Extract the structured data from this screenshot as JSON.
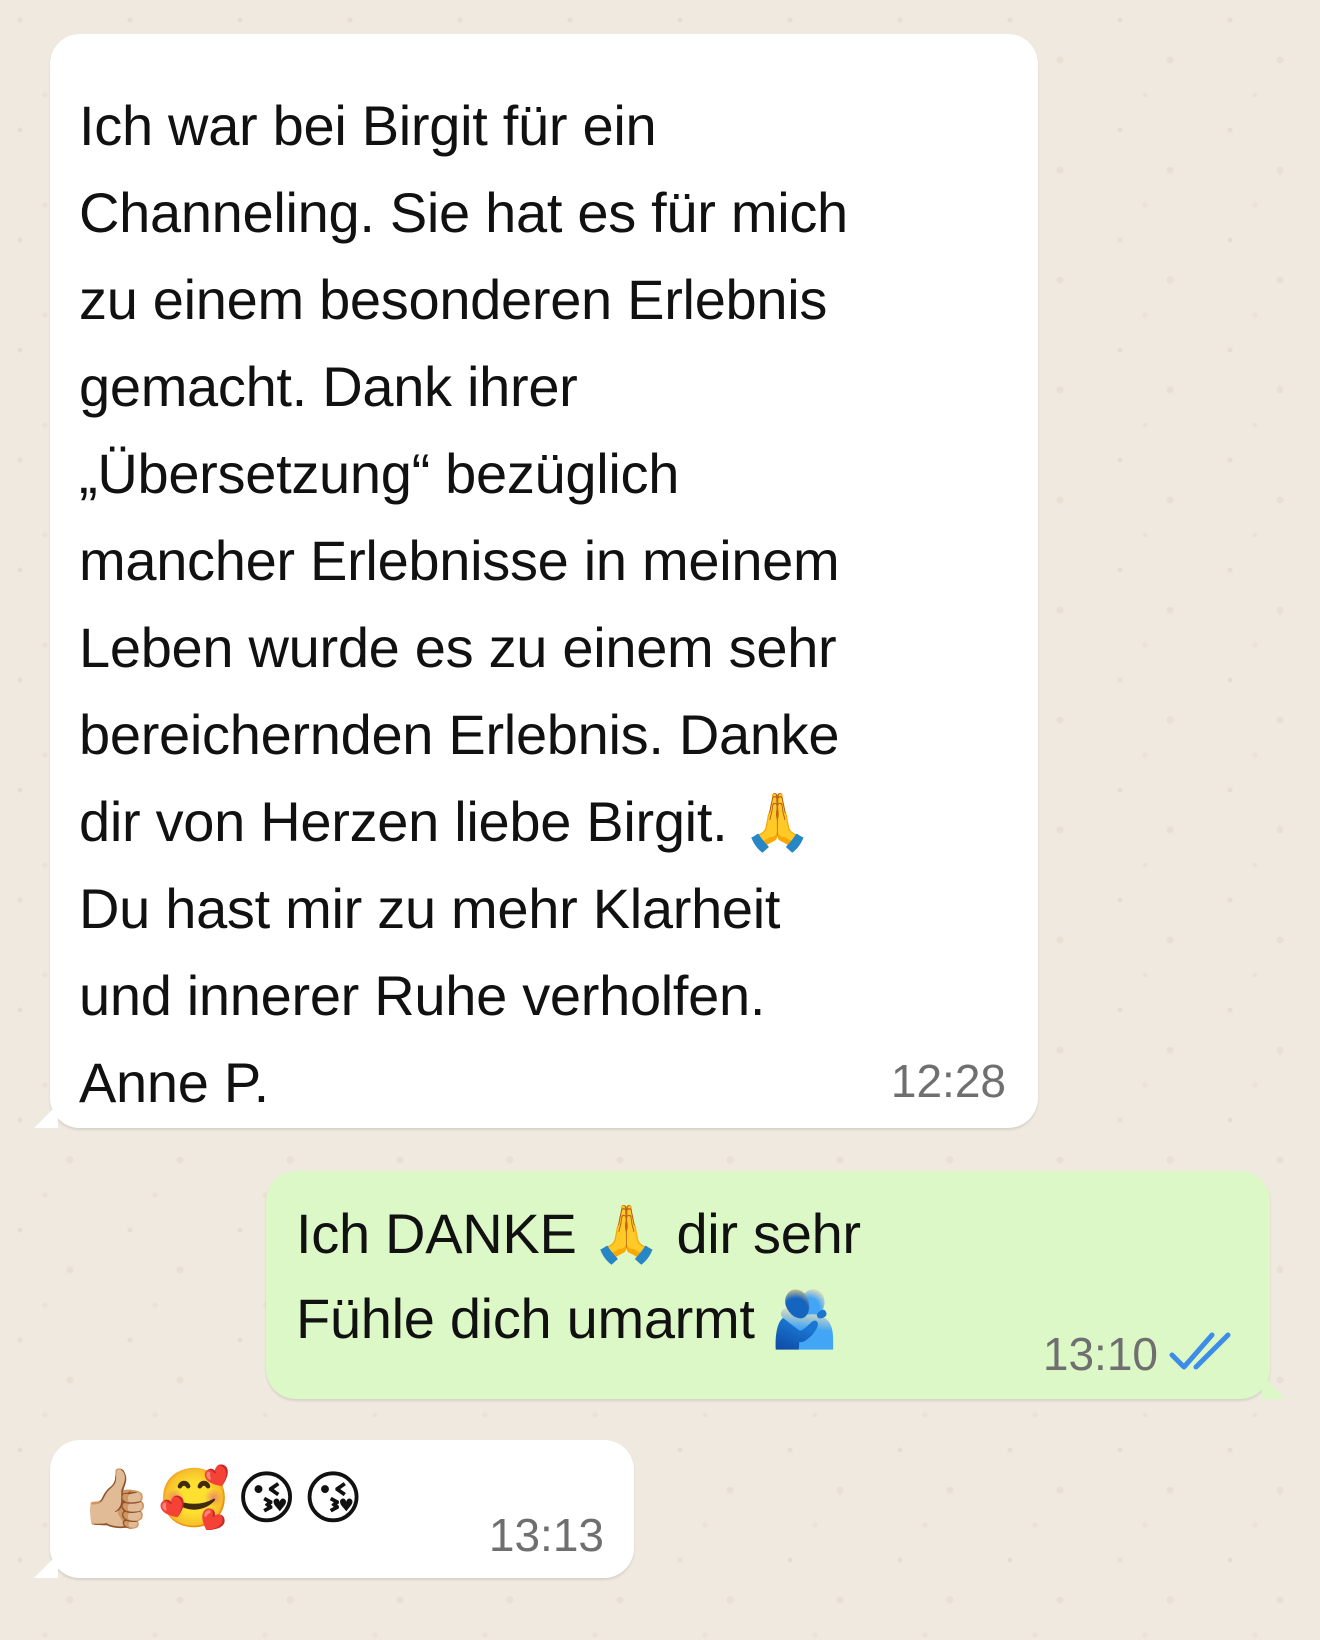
{
  "conversation": {
    "messages": [
      {
        "direction": "incoming",
        "text": "Ich war bei Birgit für ein\nChanneling. Sie hat es für mich\nzu einem besonderen Erlebnis\ngemacht. Dank ihrer\n„Übersetzung“ bezüglich\nmancher Erlebnisse in meinem\nLeben wurde es zu einem sehr\nbereichernden Erlebnis. Danke\ndir von Herzen liebe Birgit. 🙏\nDu hast mir zu mehr Klarheit\nund innerer Ruhe verholfen.\nAnne P.",
        "time": "12:28"
      },
      {
        "direction": "outgoing",
        "text": "Ich DANKE 🙏 dir sehr\nFühle dich umarmt 🫂",
        "time": "13:10",
        "status": "read",
        "tick_color": "#3c8ce8"
      },
      {
        "direction": "incoming",
        "text": "👍🏼🥰😘😘",
        "time": "13:13"
      }
    ]
  },
  "colors": {
    "incoming_bubble": "#ffffff",
    "outgoing_bubble": "#dcf8c6",
    "chat_background": "#efe9df",
    "timestamp": "#6f6f6f",
    "read_ticks": "#3c8ce8"
  }
}
